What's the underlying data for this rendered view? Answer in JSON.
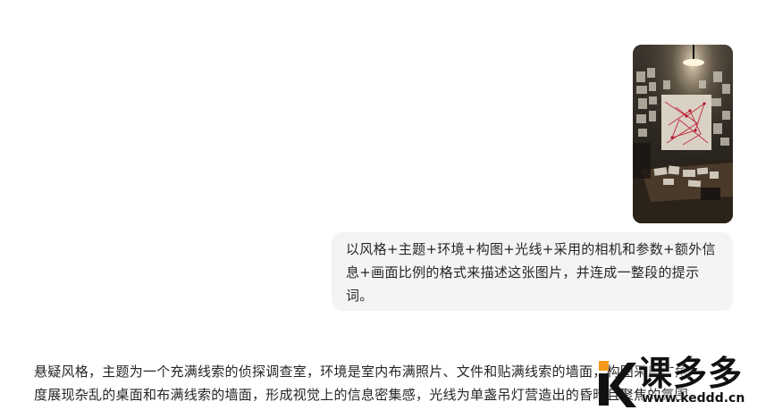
{
  "conversation": {
    "user_image": {
      "icon": "detective-room-photo"
    },
    "user_message": {
      "text": "以风格+主题+环境+构图+光线+采用的相机和参数+额外信息+画面比例的格式来描述这张图片，并连成一整段的提示词。"
    },
    "assistant_message": {
      "lines": [
        "悬疑风格，主题为一个充满线索的侦探调查室，环境是室内布满照片、文件和贴满线索的墙面，构图采用广角",
        "度展现杂乱的桌面和布满线索的墙面，形成视觉上的信息密集感，光线为单盏吊灯营造出的昏暗且聚焦的氛围"
      ]
    }
  },
  "watermark": {
    "title": "课多多",
    "url": "www.keddd.cn",
    "accent_color": "#f59a1b"
  },
  "colors": {
    "bubble_bg": "#f3f4f6",
    "text": "#262626"
  }
}
